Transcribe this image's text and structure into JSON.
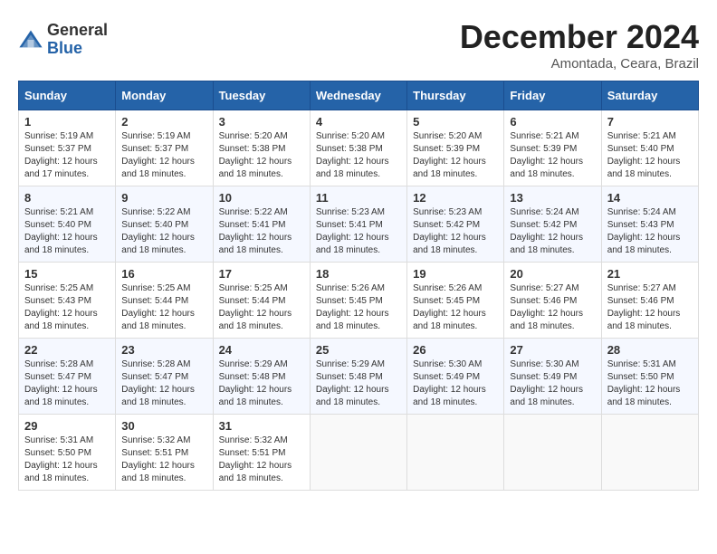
{
  "logo": {
    "general": "General",
    "blue": "Blue"
  },
  "title": "December 2024",
  "location": "Amontada, Ceara, Brazil",
  "days_of_week": [
    "Sunday",
    "Monday",
    "Tuesday",
    "Wednesday",
    "Thursday",
    "Friday",
    "Saturday"
  ],
  "weeks": [
    [
      {
        "day": "1",
        "sunrise": "5:19 AM",
        "sunset": "5:37 PM",
        "daylight": "12 hours and 17 minutes."
      },
      {
        "day": "2",
        "sunrise": "5:19 AM",
        "sunset": "5:37 PM",
        "daylight": "12 hours and 18 minutes."
      },
      {
        "day": "3",
        "sunrise": "5:20 AM",
        "sunset": "5:38 PM",
        "daylight": "12 hours and 18 minutes."
      },
      {
        "day": "4",
        "sunrise": "5:20 AM",
        "sunset": "5:38 PM",
        "daylight": "12 hours and 18 minutes."
      },
      {
        "day": "5",
        "sunrise": "5:20 AM",
        "sunset": "5:39 PM",
        "daylight": "12 hours and 18 minutes."
      },
      {
        "day": "6",
        "sunrise": "5:21 AM",
        "sunset": "5:39 PM",
        "daylight": "12 hours and 18 minutes."
      },
      {
        "day": "7",
        "sunrise": "5:21 AM",
        "sunset": "5:40 PM",
        "daylight": "12 hours and 18 minutes."
      }
    ],
    [
      {
        "day": "8",
        "sunrise": "5:21 AM",
        "sunset": "5:40 PM",
        "daylight": "12 hours and 18 minutes."
      },
      {
        "day": "9",
        "sunrise": "5:22 AM",
        "sunset": "5:40 PM",
        "daylight": "12 hours and 18 minutes."
      },
      {
        "day": "10",
        "sunrise": "5:22 AM",
        "sunset": "5:41 PM",
        "daylight": "12 hours and 18 minutes."
      },
      {
        "day": "11",
        "sunrise": "5:23 AM",
        "sunset": "5:41 PM",
        "daylight": "12 hours and 18 minutes."
      },
      {
        "day": "12",
        "sunrise": "5:23 AM",
        "sunset": "5:42 PM",
        "daylight": "12 hours and 18 minutes."
      },
      {
        "day": "13",
        "sunrise": "5:24 AM",
        "sunset": "5:42 PM",
        "daylight": "12 hours and 18 minutes."
      },
      {
        "day": "14",
        "sunrise": "5:24 AM",
        "sunset": "5:43 PM",
        "daylight": "12 hours and 18 minutes."
      }
    ],
    [
      {
        "day": "15",
        "sunrise": "5:25 AM",
        "sunset": "5:43 PM",
        "daylight": "12 hours and 18 minutes."
      },
      {
        "day": "16",
        "sunrise": "5:25 AM",
        "sunset": "5:44 PM",
        "daylight": "12 hours and 18 minutes."
      },
      {
        "day": "17",
        "sunrise": "5:25 AM",
        "sunset": "5:44 PM",
        "daylight": "12 hours and 18 minutes."
      },
      {
        "day": "18",
        "sunrise": "5:26 AM",
        "sunset": "5:45 PM",
        "daylight": "12 hours and 18 minutes."
      },
      {
        "day": "19",
        "sunrise": "5:26 AM",
        "sunset": "5:45 PM",
        "daylight": "12 hours and 18 minutes."
      },
      {
        "day": "20",
        "sunrise": "5:27 AM",
        "sunset": "5:46 PM",
        "daylight": "12 hours and 18 minutes."
      },
      {
        "day": "21",
        "sunrise": "5:27 AM",
        "sunset": "5:46 PM",
        "daylight": "12 hours and 18 minutes."
      }
    ],
    [
      {
        "day": "22",
        "sunrise": "5:28 AM",
        "sunset": "5:47 PM",
        "daylight": "12 hours and 18 minutes."
      },
      {
        "day": "23",
        "sunrise": "5:28 AM",
        "sunset": "5:47 PM",
        "daylight": "12 hours and 18 minutes."
      },
      {
        "day": "24",
        "sunrise": "5:29 AM",
        "sunset": "5:48 PM",
        "daylight": "12 hours and 18 minutes."
      },
      {
        "day": "25",
        "sunrise": "5:29 AM",
        "sunset": "5:48 PM",
        "daylight": "12 hours and 18 minutes."
      },
      {
        "day": "26",
        "sunrise": "5:30 AM",
        "sunset": "5:49 PM",
        "daylight": "12 hours and 18 minutes."
      },
      {
        "day": "27",
        "sunrise": "5:30 AM",
        "sunset": "5:49 PM",
        "daylight": "12 hours and 18 minutes."
      },
      {
        "day": "28",
        "sunrise": "5:31 AM",
        "sunset": "5:50 PM",
        "daylight": "12 hours and 18 minutes."
      }
    ],
    [
      {
        "day": "29",
        "sunrise": "5:31 AM",
        "sunset": "5:50 PM",
        "daylight": "12 hours and 18 minutes."
      },
      {
        "day": "30",
        "sunrise": "5:32 AM",
        "sunset": "5:51 PM",
        "daylight": "12 hours and 18 minutes."
      },
      {
        "day": "31",
        "sunrise": "5:32 AM",
        "sunset": "5:51 PM",
        "daylight": "12 hours and 18 minutes."
      },
      null,
      null,
      null,
      null
    ]
  ],
  "labels": {
    "sunrise": "Sunrise:",
    "sunset": "Sunset:",
    "daylight": "Daylight:"
  }
}
